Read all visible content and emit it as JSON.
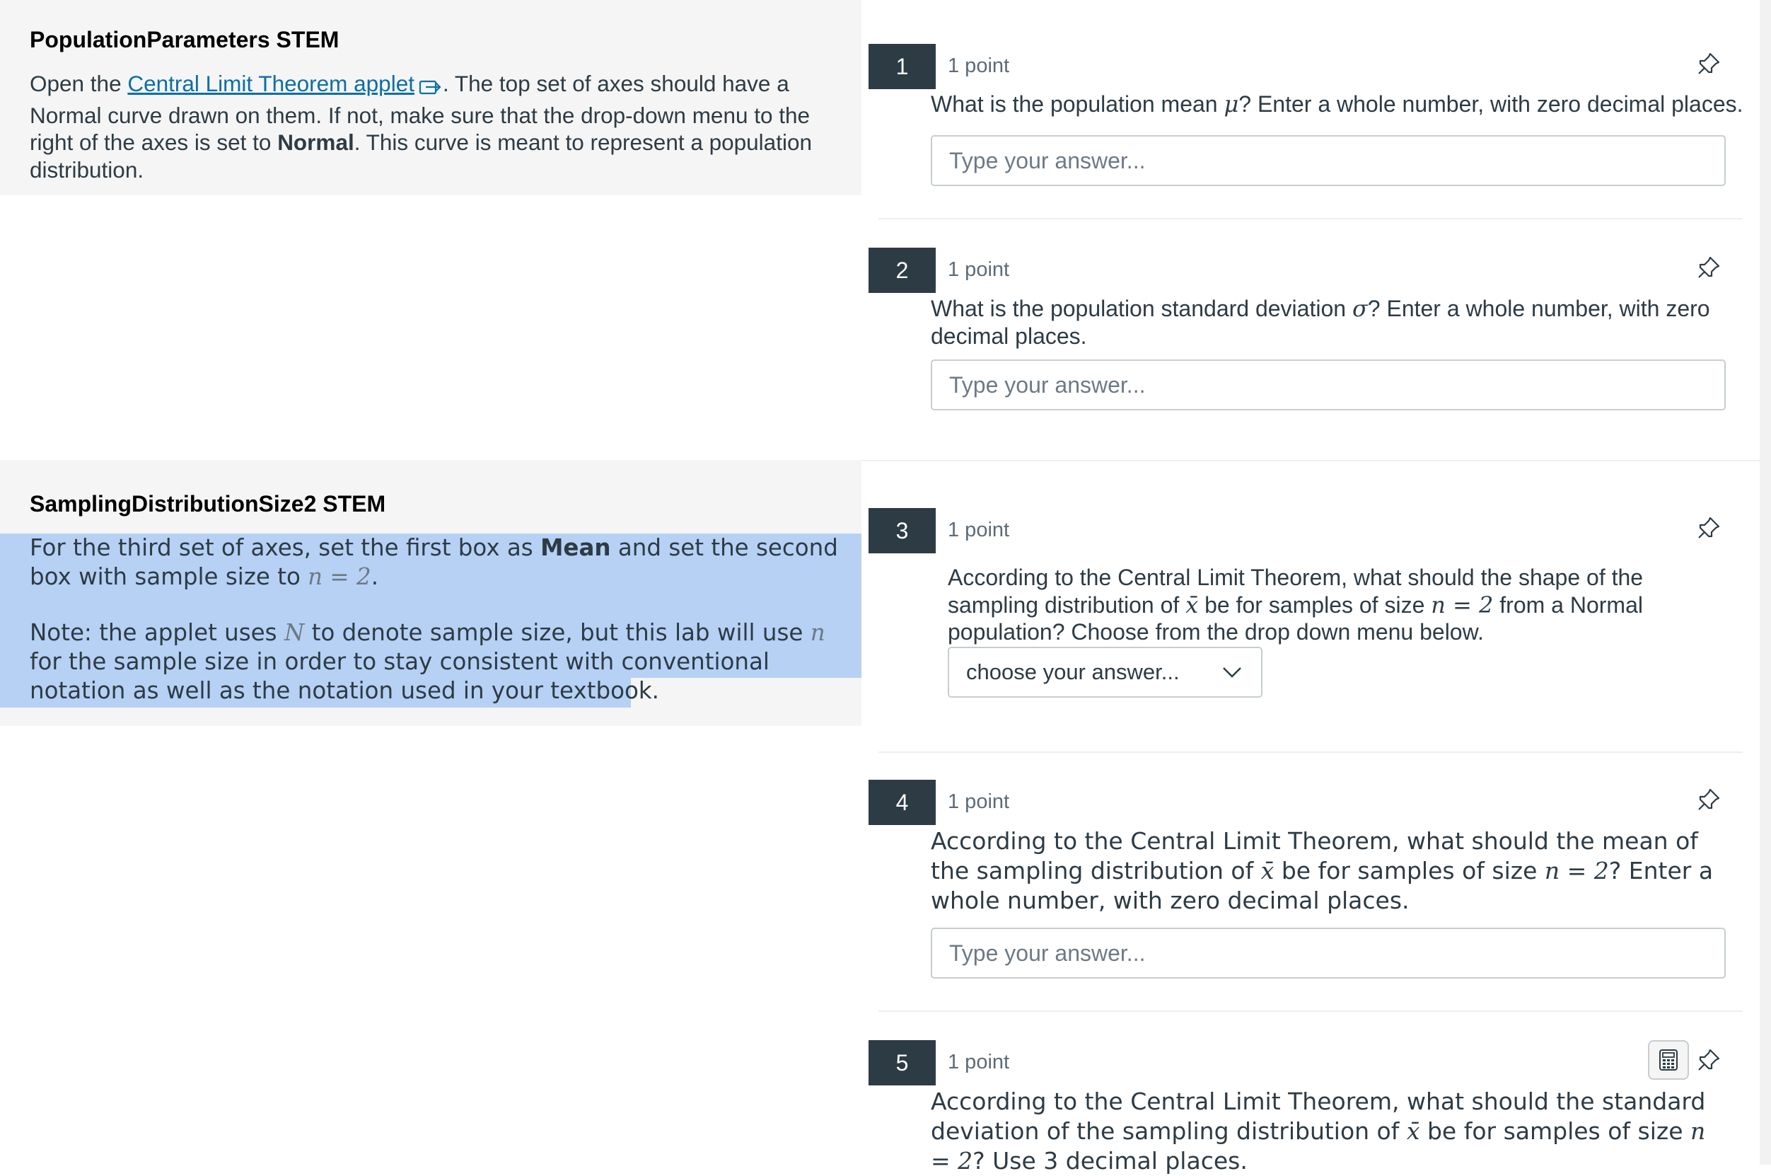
{
  "stem1": {
    "title": "PopulationParameters STEM",
    "text_before_link": "Open the ",
    "link_text": "Central Limit Theorem applet",
    "text_part1": ". The top set of axes should have a Normal curve drawn on them. If not, make sure that the drop-down menu to the right of the axes is set to ",
    "bold_word": "Normal",
    "text_part2": ". This curve is meant to represent a population distribution."
  },
  "stem2": {
    "title": "SamplingDistributionSize2 STEM",
    "para1_before": "For the third set of axes, set the first box as ",
    "para1_bold": "Mean",
    "para1_after": " and set the second box with sample size to ",
    "para1_math": "n = 2",
    "para1_end": ".",
    "para2_before": "Note: the applet uses ",
    "para2_math1": "N",
    "para2_mid": " to denote sample size, but this lab will use ",
    "para2_math2": "n",
    "para2_after": " for the sample size in order to stay consistent with conventional notation as well as the notation used in your textbook."
  },
  "questions": [
    {
      "number": "1",
      "points": "1 point",
      "text_before": "What is the population mean ",
      "math": "μ",
      "text_after": "? Enter a whole number, with zero decimal places.",
      "placeholder": "Type your answer..."
    },
    {
      "number": "2",
      "points": "1 point",
      "text_before": "What is the population standard deviation ",
      "math": "σ",
      "text_after": "? Enter a whole number, with zero decimal places.",
      "placeholder": "Type your answer..."
    },
    {
      "number": "3",
      "points": "1 point",
      "text_before": "According to the Central Limit Theorem, what should the shape of the sampling distribution of ",
      "math1": "x̄",
      "text_mid": " be for samples of size ",
      "math2": "n = 2",
      "text_after": " from a Normal population? Choose from the drop down menu below.",
      "select_value": "choose your answer..."
    },
    {
      "number": "4",
      "points": "1 point",
      "text_before": "According to the Central Limit Theorem, what should the mean of the sampling distribution of ",
      "math1": "x̄",
      "text_mid": " be for samples of size ",
      "math2": "n = 2",
      "text_after": "? Enter a whole number, with zero decimal places.",
      "placeholder": "Type your answer..."
    },
    {
      "number": "5",
      "points": "1 point",
      "text_before": "According to the Central Limit Theorem, what should the standard deviation of the sampling distribution of ",
      "math1": "x̄",
      "text_mid": " be for samples of size ",
      "math2": "n = 2",
      "text_after": "? Use 3 decimal places."
    }
  ],
  "icons": {
    "pin": "pin-icon",
    "external_link": "external-link-icon",
    "calculator": "calculator-icon",
    "dropdown": "chevron-down-icon"
  }
}
